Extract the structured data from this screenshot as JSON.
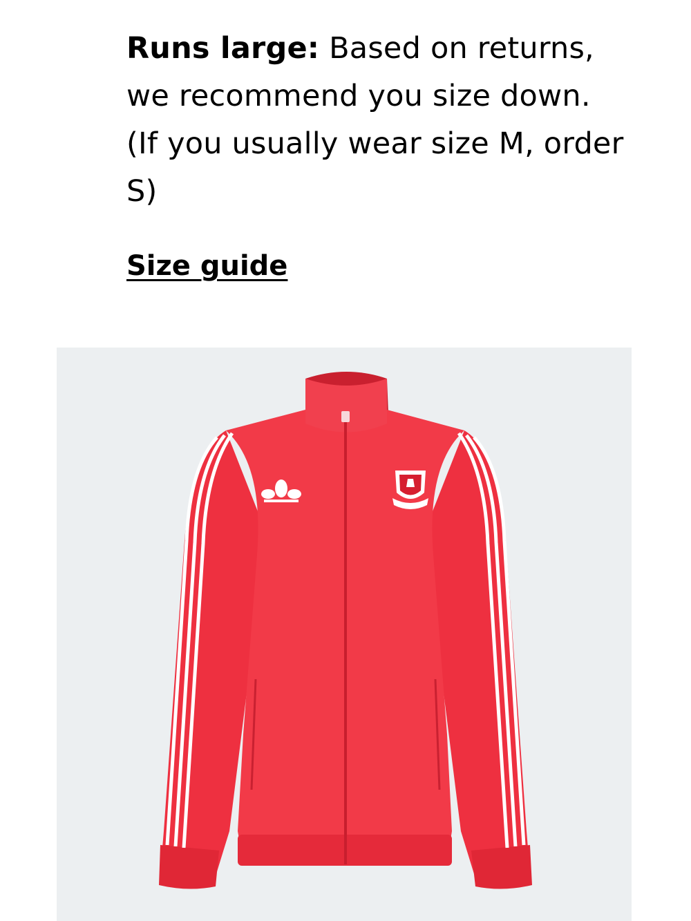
{
  "fit_note": {
    "lead": "Runs large:",
    "text": "Based on returns, we recommend you size down. (If you usually wear size M, order S)"
  },
  "size_guide": {
    "label": "Size guide"
  },
  "product_image": {
    "subject": "red track jacket with white three stripes, trefoil logo and club crest",
    "colors": {
      "background": "#eceff1",
      "jacket": "#ef3443",
      "stripes": "#ffffff"
    }
  }
}
